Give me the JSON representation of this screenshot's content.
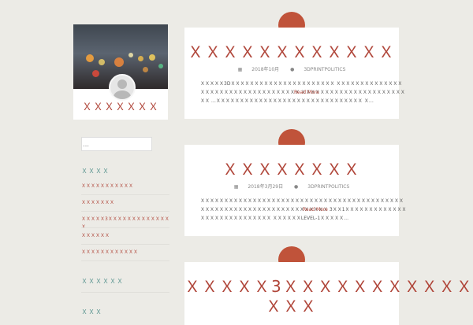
{
  "sidebar": {
    "site_title": "ＸＸＸＸＸＸＸ",
    "search_placeholder": "…",
    "widget1_title": "ＸＸＸＸ",
    "widget1_links": [
      "ＸＸＸＸＸＸＸＸＸＸＸ",
      "ＸＸＸＸＸＸＸ",
      "ＸＸＸＸＸ3ＸＸＸＸＸＸＸＸＸＸＸＸＸＸ",
      "ＸＸＸＸＸＸ",
      "ＸＸＸＸＸＸＸＸＸＸＸＸ"
    ],
    "widget2_title": "ＸＸＸＸＸＸ",
    "widget3_title": "ＸＸＸ"
  },
  "posts": [
    {
      "title": "ＸＸＸＸＸＸＸＸＸＸＸＸ",
      "date": "2018年10月",
      "author": "3DPRINTPOLITICS",
      "excerpt": "ＸＸＸＸＸ3DＸＸＸＸＸＸＸＸＸＸＸＸＸＸＸＸＸＸＸＸＸＸ ＸＸＸＸＸＸＸＸＸＸＸＸＸＸＸＸＸＸＸＸＸＸＸＸＸＸＸＸＸＸＸＸＸＸＸ ＸＸＸＸＸＸＸＸＸＸＸＸＸＸＸＸＸＸＸＸＸＸＸＸ …ＸＸＸＸＸＸＸＸＸＸＸＸＸＸＸＸＸＸＸＸＸＸＸＸＸＸＸＸＸＸＸ Ｘ…",
      "read_more": "Read More"
    },
    {
      "title": "ＸＸＸＸＸＸＸＸ",
      "date": "2018年3月29日",
      "author": "3DPRINTPOLITICS",
      "excerpt": "ＸＸＸＸＸＸＸＸＸＸＸＸＸＸＸＸＸＸＸＸＸＸＸＸＸＸＸＸＸＸＸＸＸＸＸＸＸＸＸＸＸＸＸＸＸＸＸＸＸＸＸＸＸＸＸＸＸＸＸＸＸＸＸＸＸＸＸＸＸＸ 3ＸＸ1ＸＸＸＸＸＸＸＸＸＸＸＸＸＸＸＸＸＸＸＸＸＸＸＸＸＸＸＸ ＸＸＸＸＸＸLEVEL-1ＸＸＸＸＸ…",
      "read_more": "Read More"
    },
    {
      "title_line1": "ＸＸＸＸＸ3ＸＸＸＸＸＸＸＸＸＸＸＸ",
      "title_line2": "ＸＸＸ"
    }
  ]
}
